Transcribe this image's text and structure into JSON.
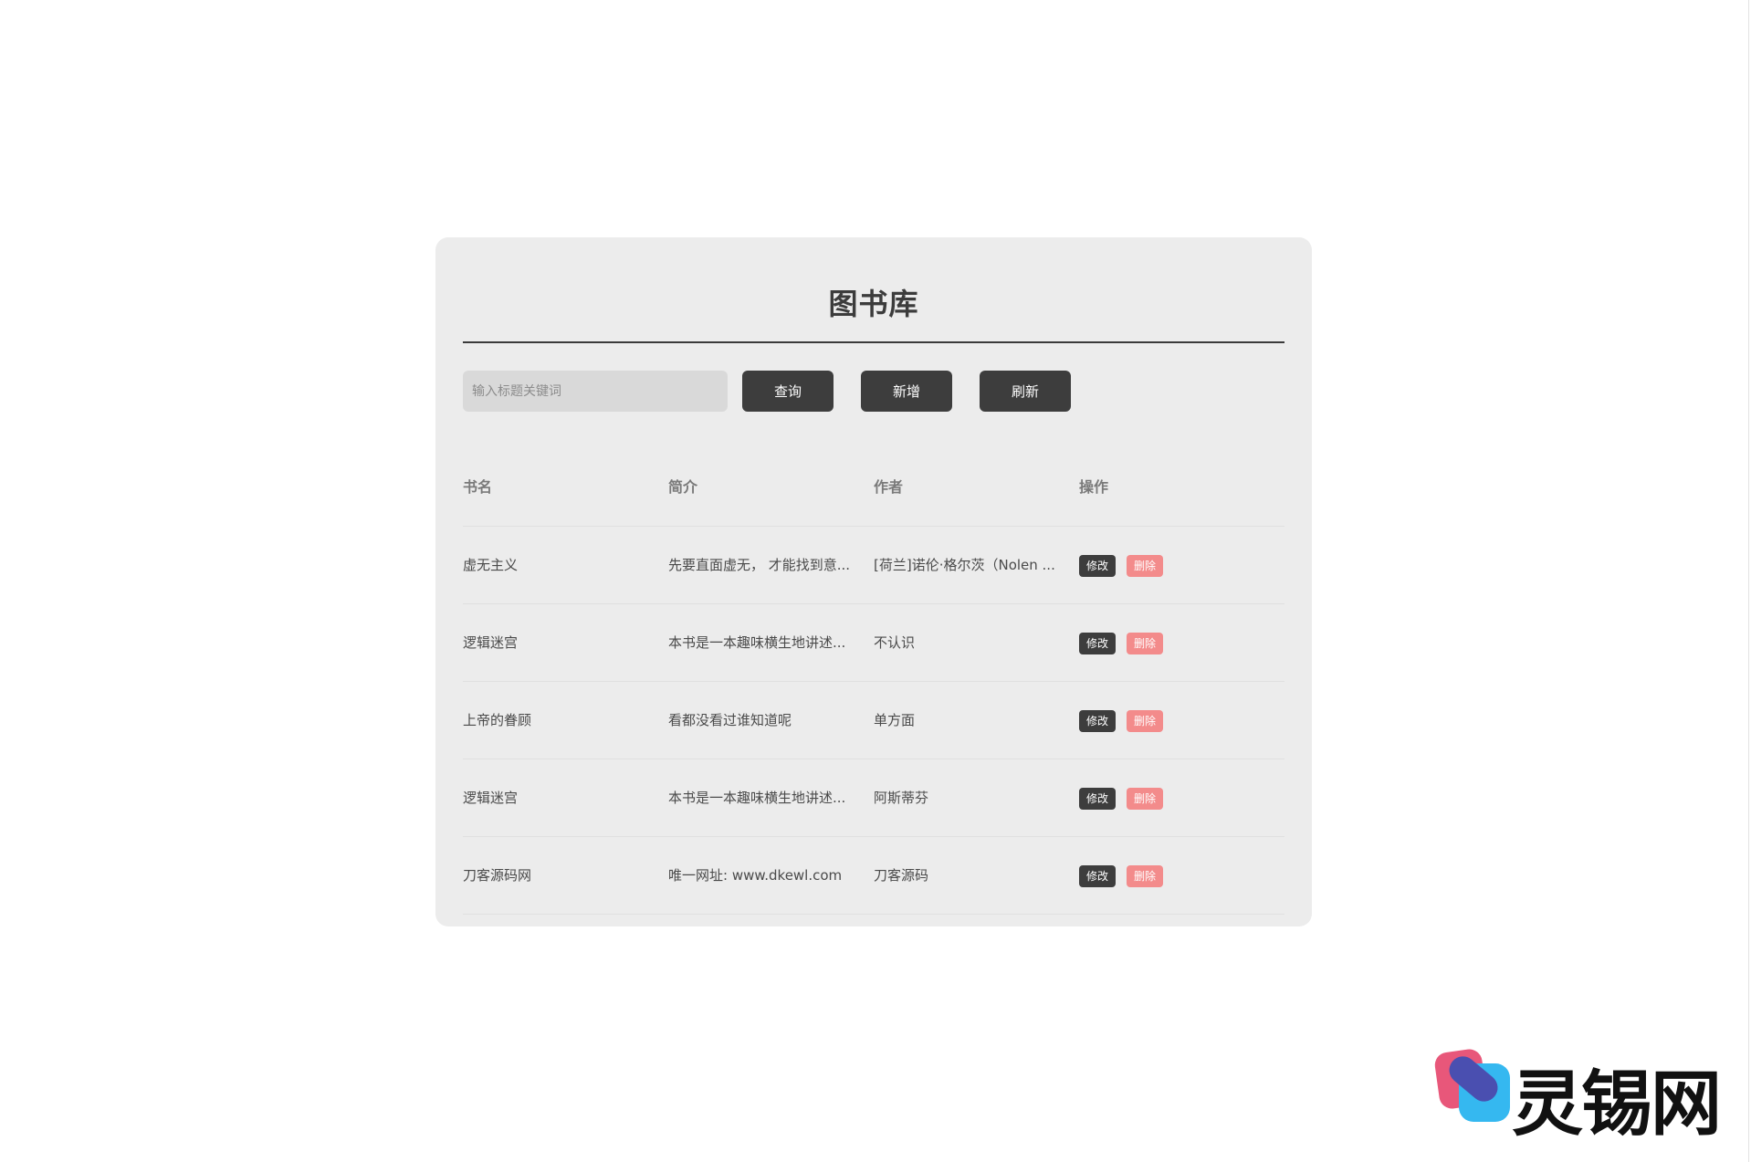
{
  "page": {
    "title": "图书库"
  },
  "search": {
    "placeholder": "输入标题关键词",
    "value": ""
  },
  "toolbar": {
    "query_label": "查询",
    "add_label": "新增",
    "refresh_label": "刷新"
  },
  "table": {
    "columns": [
      "书名",
      "简介",
      "作者",
      "操作"
    ],
    "rows": [
      {
        "title": "虚无主义",
        "desc": "先要直面虚无， 才能找到意...",
        "author": "[荷兰]诺伦·格尔茨（Nolen ...",
        "edit": "修改",
        "delete": "删除"
      },
      {
        "title": "逻辑迷宫",
        "desc": "本书是一本趣味横生地讲述...",
        "author": "不认识",
        "edit": "修改",
        "delete": "删除"
      },
      {
        "title": "上帝的眷顾",
        "desc": "看都没看过谁知道呢",
        "author": "单方面",
        "edit": "修改",
        "delete": "删除"
      },
      {
        "title": "逻辑迷宫",
        "desc": "本书是一本趣味横生地讲述...",
        "author": "阿斯蒂芬",
        "edit": "修改",
        "delete": "删除"
      },
      {
        "title": "刀客源码网",
        "desc": "唯一网址: www.dkewl.com",
        "author": "刀客源码",
        "edit": "修改",
        "delete": "删除"
      }
    ]
  },
  "watermark": {
    "text": "灵锡网"
  },
  "colors": {
    "panel_bg": "#ececec",
    "button_dark": "#3d3d3d",
    "delete_pink": "#f38b8b",
    "input_bg": "#d9d9d9"
  }
}
